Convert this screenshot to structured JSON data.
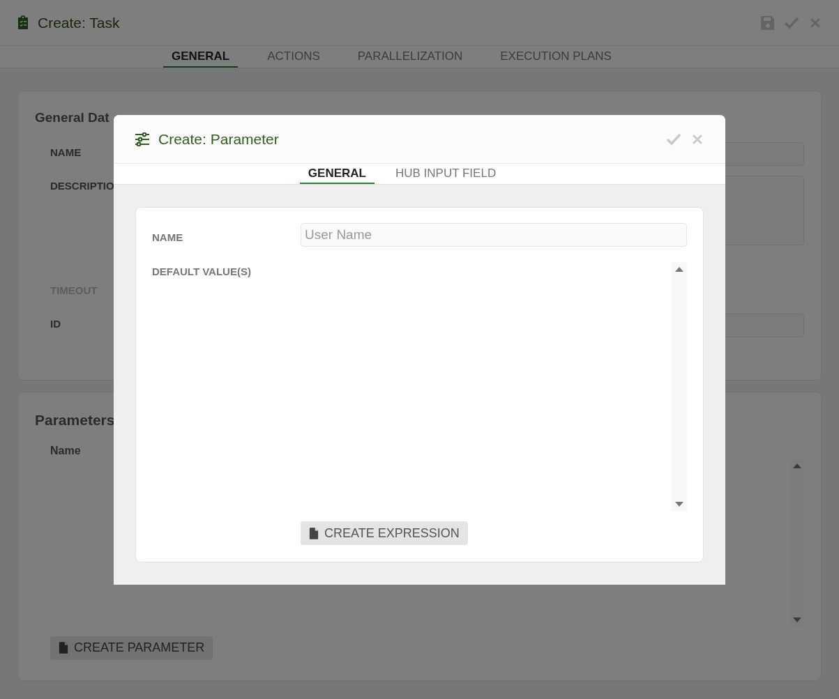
{
  "task_window": {
    "title": "Create: Task",
    "tabs": [
      {
        "label": "GENERAL",
        "selected": true
      },
      {
        "label": "ACTIONS",
        "selected": false
      },
      {
        "label": "PARALLELIZATION",
        "selected": false
      },
      {
        "label": "EXECUTION PLANS",
        "selected": false
      }
    ],
    "general_data": {
      "title": "General Dat",
      "fields": [
        {
          "label": "NAME",
          "kind": "input",
          "disabled": false
        },
        {
          "label": "DESCRIPTIO",
          "kind": "textarea",
          "disabled": false
        },
        {
          "label": "TIMEOUT",
          "kind": "none",
          "disabled": true
        },
        {
          "label": "ID",
          "kind": "input",
          "disabled": false
        }
      ]
    },
    "parameters": {
      "title": "Parameters",
      "columns": [
        "Name"
      ],
      "create_button": "CREATE PARAMETER"
    }
  },
  "dialog": {
    "title": "Create: Parameter",
    "tabs": [
      {
        "label": "GENERAL",
        "selected": true
      },
      {
        "label": "HUB INPUT FIELD",
        "selected": false
      }
    ],
    "fields": [
      {
        "label": "NAME",
        "kind": "input",
        "placeholder": "User Name"
      },
      {
        "label": "DEFAULT VALUE(S)",
        "kind": "list"
      }
    ],
    "create_button": "CREATE EXPRESSION"
  }
}
